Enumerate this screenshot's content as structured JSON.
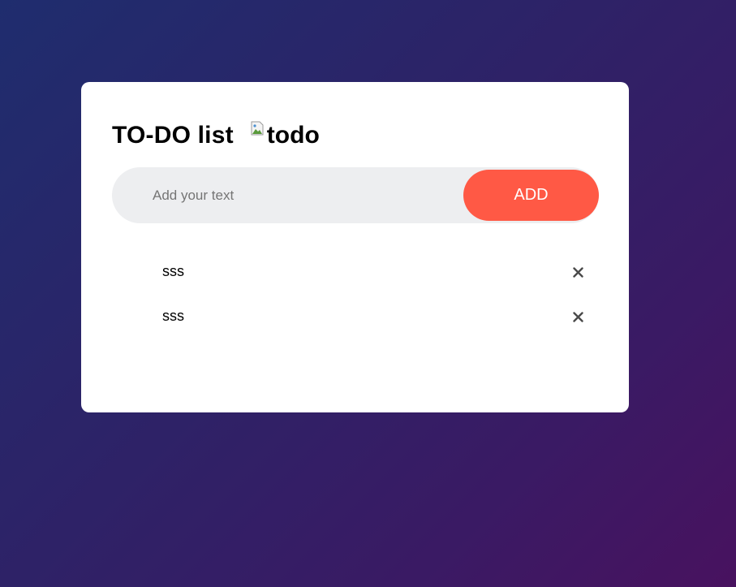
{
  "header": {
    "title": "TO-DO list",
    "image_alt": "todo"
  },
  "input": {
    "placeholder": "Add your text",
    "value": ""
  },
  "add_button": {
    "label": "ADD"
  },
  "tasks": [
    {
      "text": "sss"
    },
    {
      "text": "sss"
    }
  ],
  "icons": {
    "broken_image": "broken-image-icon",
    "remove": "close-icon"
  },
  "colors": {
    "accent": "#ff5945",
    "input_bg": "#edeef0",
    "card_bg": "#ffffff",
    "bg_start": "#1f2d6e",
    "bg_end": "#48125f"
  }
}
